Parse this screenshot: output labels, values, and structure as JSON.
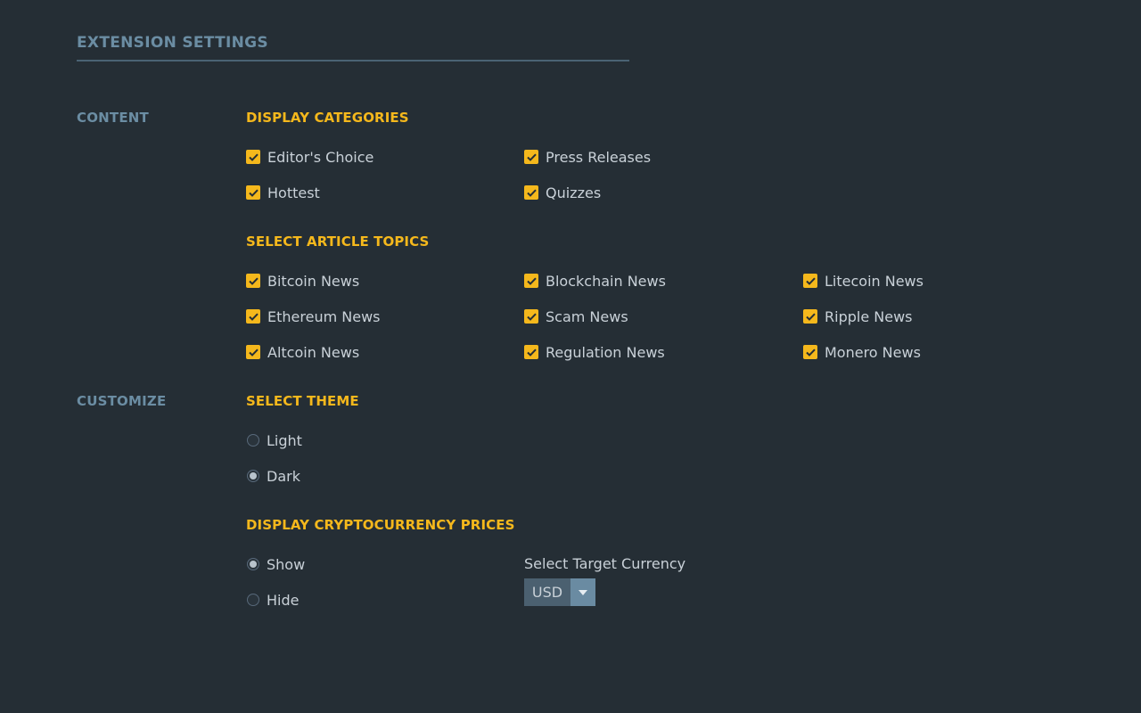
{
  "page": {
    "title": "EXTENSION SETTINGS"
  },
  "sections": {
    "content_label": "CONTENT",
    "customize_label": "CUSTOMIZE"
  },
  "display_categories": {
    "heading": "DISPLAY CATEGORIES",
    "items": [
      {
        "label": "Editor's Choice",
        "checked": true
      },
      {
        "label": "Press Releases",
        "checked": true
      },
      {
        "label": "Hottest",
        "checked": true
      },
      {
        "label": "Quizzes",
        "checked": true
      }
    ]
  },
  "article_topics": {
    "heading": "SELECT ARTICLE TOPICS",
    "items": [
      {
        "label": "Bitcoin News",
        "checked": true
      },
      {
        "label": "Blockchain News",
        "checked": true
      },
      {
        "label": "Litecoin News",
        "checked": true
      },
      {
        "label": "Ethereum News",
        "checked": true
      },
      {
        "label": "Scam News",
        "checked": true
      },
      {
        "label": "Ripple News",
        "checked": true
      },
      {
        "label": "Altcoin News",
        "checked": true
      },
      {
        "label": "Regulation News",
        "checked": true
      },
      {
        "label": "Monero News",
        "checked": true
      }
    ]
  },
  "theme": {
    "heading": "SELECT THEME",
    "options": [
      {
        "label": "Light",
        "selected": false
      },
      {
        "label": "Dark",
        "selected": true
      }
    ]
  },
  "prices": {
    "heading": "DISPLAY CRYPTOCURRENCY PRICES",
    "options": [
      {
        "label": "Show",
        "selected": true
      },
      {
        "label": "Hide",
        "selected": false
      }
    ],
    "currency_label": "Select Target Currency",
    "currency_value": "USD"
  },
  "colors": {
    "background": "#252e35",
    "accent": "#f5b81c",
    "section_label": "#6b8da3",
    "text": "#c9d1d8"
  },
  "icons": {
    "checkbox_checked": "check-icon",
    "dropdown": "caret-down-icon"
  }
}
